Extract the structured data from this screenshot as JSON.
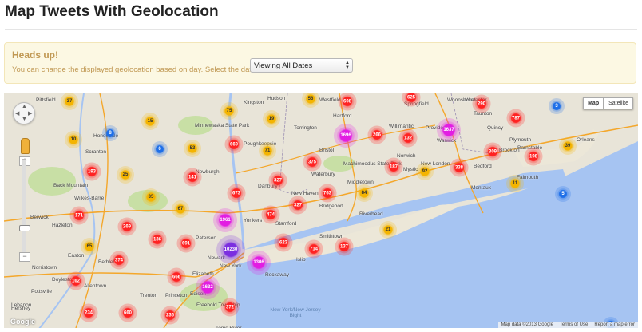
{
  "page": {
    "title": "Map Tweets With Geolocation"
  },
  "alert": {
    "heading": "Heads up!",
    "text": "You can change the displayed geolocation based on day. Select the date here:",
    "select_value": "Viewing All Dates"
  },
  "map": {
    "type_buttons": [
      "Map",
      "Satellite"
    ],
    "attribution": [
      "Map data ©2013 Google",
      "Terms of Use",
      "Report a map error"
    ],
    "logo": "Google",
    "water_label": "New York/New Jersey Bight",
    "places": [
      "Hudson",
      "Honesdale",
      "Newburgh",
      "Danbury",
      "Hartford",
      "Bristol",
      "Willimantic",
      "Providence",
      "Warwick",
      "Taunton",
      "Bedford",
      "Plymouth",
      "Barnstable",
      "Falmouth",
      "Orleans",
      "New Haven",
      "Waterbury",
      "Middletown",
      "Bridgeport",
      "Stamford",
      "Yonkers",
      "New York",
      "Paterson",
      "Newark",
      "Elizabeth",
      "Edison",
      "Trenton",
      "Allentown",
      "Bethlehem",
      "Hazleton",
      "Berwick",
      "Pottsville",
      "Lebanon",
      "Hershey",
      "Freehold Township",
      "Toms River",
      "Princeton",
      "Islip",
      "Rockaway",
      "Torrington",
      "Kingston",
      "Poughkeepsie",
      "Pittsfield",
      "Westfield",
      "Springfield",
      "Worcester",
      "Woonsocket",
      "Brockton",
      "Quincy",
      "Norwich",
      "New London",
      "Mystic",
      "Montauk",
      "Riverhead",
      "Smithtown",
      "Minnewaska State Park",
      "Machimoodus State Park",
      "Back Mountain",
      "Wilkes-Barre",
      "Scranton",
      "Easton",
      "Doylestown",
      "Norristown"
    ],
    "colors": {
      "red": "#ff2222",
      "yellow": "#f4b400",
      "blue": "#1e6fe8",
      "pink": "#e21de2",
      "purple": "#7b2ee0",
      "land": "#e8e4d8",
      "water": "#a6c4f2",
      "park": "#c8dfa5",
      "highway": "#f4a72b"
    },
    "clusters": [
      {
        "label": "37",
        "color": "yellow"
      },
      {
        "label": "10",
        "color": "yellow"
      },
      {
        "label": "8",
        "color": "blue"
      },
      {
        "label": "15",
        "color": "yellow"
      },
      {
        "label": "75",
        "color": "yellow"
      },
      {
        "label": "6",
        "color": "blue"
      },
      {
        "label": "53",
        "color": "yellow"
      },
      {
        "label": "660",
        "color": "red"
      },
      {
        "label": "19",
        "color": "yellow"
      },
      {
        "label": "71",
        "color": "yellow"
      },
      {
        "label": "56",
        "color": "yellow"
      },
      {
        "label": "193",
        "color": "red"
      },
      {
        "label": "25",
        "color": "yellow"
      },
      {
        "label": "141",
        "color": "red"
      },
      {
        "label": "35",
        "color": "yellow"
      },
      {
        "label": "673",
        "color": "red"
      },
      {
        "label": "327",
        "color": "red"
      },
      {
        "label": "375",
        "color": "red"
      },
      {
        "label": "1696",
        "color": "pink"
      },
      {
        "label": "266",
        "color": "red"
      },
      {
        "label": "132",
        "color": "red"
      },
      {
        "label": "1637",
        "color": "pink"
      },
      {
        "label": "3",
        "color": "blue"
      },
      {
        "label": "290",
        "color": "red"
      },
      {
        "label": "787",
        "color": "red"
      },
      {
        "label": "39",
        "color": "yellow"
      },
      {
        "label": "309",
        "color": "red"
      },
      {
        "label": "198",
        "color": "red"
      },
      {
        "label": "338",
        "color": "red"
      },
      {
        "label": "92",
        "color": "yellow"
      },
      {
        "label": "187",
        "color": "red"
      },
      {
        "label": "11",
        "color": "yellow"
      },
      {
        "label": "5",
        "color": "blue"
      },
      {
        "label": "67",
        "color": "yellow"
      },
      {
        "label": "763",
        "color": "red"
      },
      {
        "label": "84",
        "color": "yellow"
      },
      {
        "label": "327",
        "color": "red"
      },
      {
        "label": "171",
        "color": "red"
      },
      {
        "label": "269",
        "color": "red"
      },
      {
        "label": "1961",
        "color": "pink"
      },
      {
        "label": "474",
        "color": "red"
      },
      {
        "label": "21",
        "color": "yellow"
      },
      {
        "label": "65",
        "color": "yellow"
      },
      {
        "label": "136",
        "color": "red"
      },
      {
        "label": "691",
        "color": "red"
      },
      {
        "label": "374",
        "color": "red"
      },
      {
        "label": "10230",
        "color": "purple"
      },
      {
        "label": "1306",
        "color": "pink"
      },
      {
        "label": "623",
        "color": "red"
      },
      {
        "label": "714",
        "color": "red"
      },
      {
        "label": "137",
        "color": "red"
      },
      {
        "label": "162",
        "color": "red"
      },
      {
        "label": "666",
        "color": "red"
      },
      {
        "label": "1632",
        "color": "pink"
      },
      {
        "label": "234",
        "color": "red"
      },
      {
        "label": "660",
        "color": "red"
      },
      {
        "label": "372",
        "color": "red"
      },
      {
        "label": "236",
        "color": "red"
      },
      {
        "label": "608",
        "color": "red"
      },
      {
        "label": "625",
        "color": "red"
      },
      {
        "label": "2",
        "color": "blue"
      }
    ]
  }
}
